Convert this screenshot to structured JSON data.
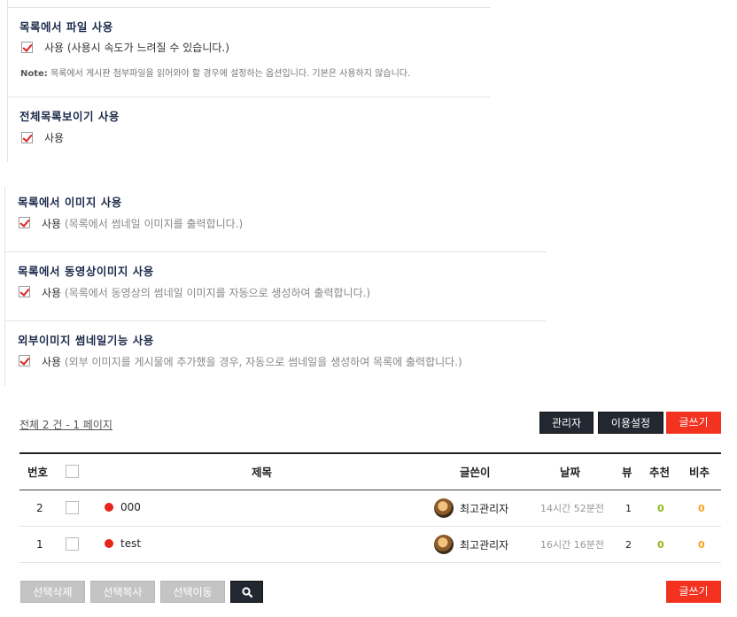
{
  "settings": [
    {
      "title": "목록에서 파일 사용",
      "option": "사용 (사용시 속도가 느려질 수 있습니다.)",
      "desc": "",
      "note_label": "Note:",
      "note": "목록에서 게시판 첨부파일을 읽어와야 할 경우에 설정하는 옵션입니다. 기본은 사용하지 않습니다."
    },
    {
      "title": "전체목록보이기 사용",
      "option": "사용",
      "desc": ""
    },
    {
      "title": "목록에서 이미지 사용",
      "option": "사용",
      "desc": "(목록에서 썸네일 이미지를 출력합니다.)"
    },
    {
      "title": "목록에서 동영상이미지 사용",
      "option": "사용",
      "desc": "(목록에서 동영상의 썸네일 이미지를 자동으로 생성하여 출력합니다.)"
    },
    {
      "title": "외부이미지 썸네일기능 사용",
      "option": "사용",
      "desc": "(외부 이미지를 게시물에 추가했을 경우, 자동으로 썸네일을 생성하여 목록에 출력합니다.)"
    }
  ],
  "board": {
    "page_info": "전체 2 건 - 1 페이지",
    "buttons": {
      "admin": "관리자",
      "settings": "이용설정",
      "write": "글쓰기"
    },
    "headers": {
      "num": "번호",
      "subject": "제목",
      "writer": "글쓴이",
      "date": "날짜",
      "views": "뷰",
      "recommend": "추천",
      "nonrecommend": "비추"
    },
    "rows": [
      {
        "num": "2",
        "subject": "000",
        "writer": "최고관리자",
        "date": "14시간 52분전",
        "views": "1",
        "recommend": "0",
        "nonrecommend": "0"
      },
      {
        "num": "1",
        "subject": "test",
        "writer": "최고관리자",
        "date": "16시간 16분전",
        "views": "2",
        "recommend": "0",
        "nonrecommend": "0"
      }
    ],
    "bottom_buttons": {
      "delete": "선택삭제",
      "copy": "선택복사",
      "move": "선택이동",
      "write": "글쓰기"
    },
    "search_icon": "search-icon"
  }
}
